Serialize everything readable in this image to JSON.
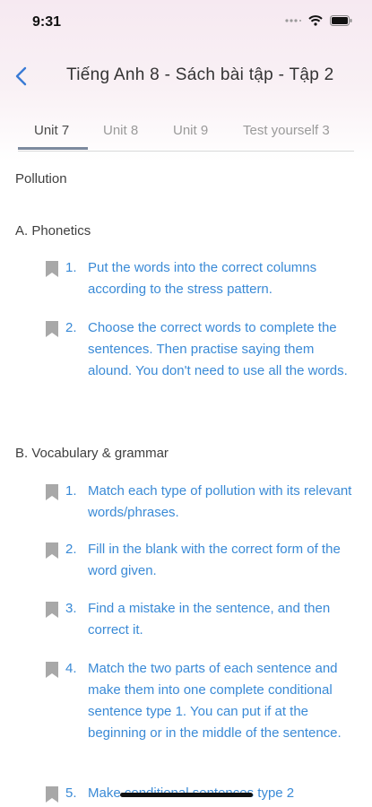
{
  "status_bar": {
    "time": "9:31"
  },
  "nav": {
    "title": "Tiếng Anh 8 - Sách bài tập - Tập 2"
  },
  "tabs": [
    {
      "label": "Unit 7",
      "active": true
    },
    {
      "label": "Unit 8",
      "active": false
    },
    {
      "label": "Unit 9",
      "active": false
    },
    {
      "label": "Test yourself 3",
      "active": false
    }
  ],
  "unit_title": "Pollution",
  "sections": [
    {
      "label": "A. Phonetics",
      "items": [
        {
          "num": "1.",
          "text": "Put the words into the correct columns according to the stress pattern."
        },
        {
          "num": "2.",
          "text": "Choose the correct words to complete the sentences. Then practise saying them alound. You don't need to use all the words."
        }
      ]
    },
    {
      "label": "B. Vocabulary & grammar",
      "items": [
        {
          "num": "1.",
          "text": "Match each type of pollution with its relevant words/phrases."
        },
        {
          "num": "2.",
          "text": "Fill in the blank with the correct form of the word given."
        },
        {
          "num": "3.",
          "text": "Find a mistake in the sentence, and then correct it."
        },
        {
          "num": "4.",
          "text": "Match the two parts of each sentence and make them into one complete conditional sentence type 1. You can put if at the beginning or in the middle of the sentence."
        },
        {
          "num": "5.",
          "text": "Make conditional sentences type 2"
        }
      ]
    }
  ],
  "colors": {
    "link": "#3a8ad6",
    "bookmark": "#a8a8a8",
    "tab_underline": "#7c8a9e"
  }
}
